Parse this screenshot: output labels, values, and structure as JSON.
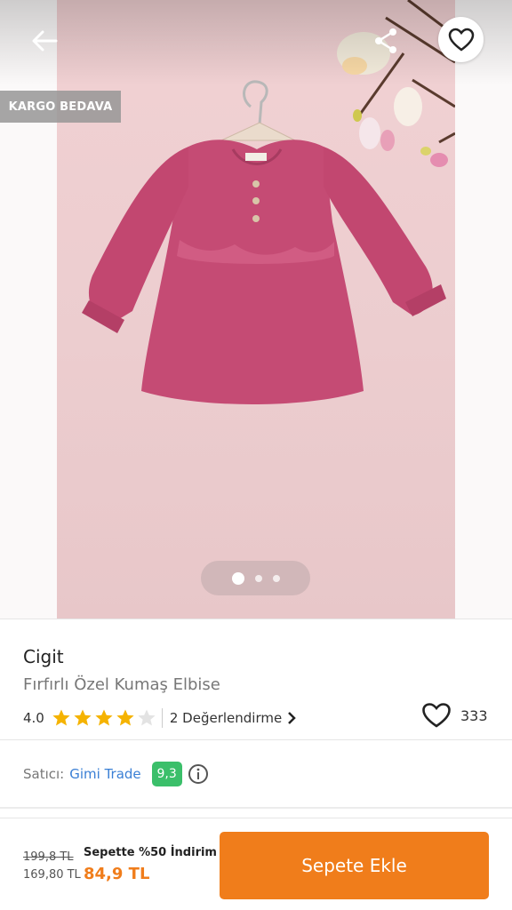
{
  "header": {
    "back_icon": "arrow-left-icon",
    "share_icon": "share-icon",
    "favorite_icon": "heart-outline-icon",
    "badge": "KARGO BEDAVA"
  },
  "gallery": {
    "image_count": 3,
    "active_index": 0
  },
  "product": {
    "brand": "Cigit",
    "name": "Fırfırlı Özel Kumaş Elbise",
    "rating": "4.0",
    "rating_stars": 4,
    "rating_max": 5,
    "reviews_label": "2 Değerlendirme",
    "likes": "333"
  },
  "seller": {
    "label": "Satıcı:",
    "name": "Gimi Trade",
    "score": "9,3"
  },
  "price": {
    "old": "199,8 TL",
    "previous": "169,80 TL",
    "promo": "Sepette %50 İndirim",
    "final": "84,9 TL"
  },
  "actions": {
    "add_to_cart": "Sepete Ekle"
  },
  "colors": {
    "accent": "#f07d1b",
    "link": "#3a7fd5",
    "score_badge": "#3bbf6a",
    "star": "#f5b301"
  }
}
